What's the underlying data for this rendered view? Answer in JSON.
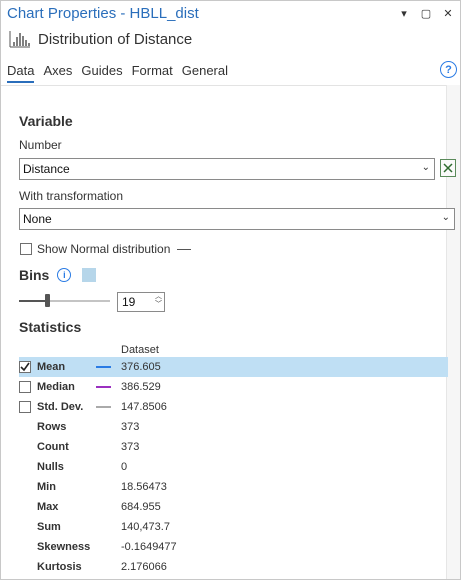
{
  "window": {
    "title": "Chart Properties - HBLL_dist",
    "pin_glyph": "▾",
    "restore_glyph": "▢",
    "close_glyph": "✕"
  },
  "chart": {
    "subtitle": "Distribution of Distance"
  },
  "tabs": [
    {
      "label": "Data",
      "active": true
    },
    {
      "label": "Axes"
    },
    {
      "label": "Guides"
    },
    {
      "label": "Format"
    },
    {
      "label": "General"
    }
  ],
  "help_glyph": "?",
  "variable": {
    "section_title": "Variable",
    "number_label": "Number",
    "number_value": "Distance",
    "transform_label": "With transformation",
    "transform_value": "None",
    "show_normal_label": "Show Normal distribution",
    "show_normal_checked": false
  },
  "bins": {
    "title": "Bins",
    "info_glyph": "i",
    "count": "19",
    "slider_fraction": 0.3,
    "color": "#b6d6ea"
  },
  "statistics": {
    "section_title": "Statistics",
    "column_header": "Dataset",
    "toggles": [
      {
        "name": "Mean",
        "value": "376.605",
        "checked": true,
        "color": "#2a7be4",
        "selected": true
      },
      {
        "name": "Median",
        "value": "386.529",
        "checked": false,
        "color": "#9b30c0"
      },
      {
        "name": "Std. Dev.",
        "value": "147.8506",
        "checked": false,
        "color": "#aaaaaa"
      }
    ],
    "rows": [
      {
        "name": "Rows",
        "value": "373"
      },
      {
        "name": "Count",
        "value": "373"
      },
      {
        "name": "Nulls",
        "value": "0"
      },
      {
        "name": "Min",
        "value": "18.56473"
      },
      {
        "name": "Max",
        "value": "684.955"
      },
      {
        "name": "Sum",
        "value": "140,473.7"
      },
      {
        "name": "Skewness",
        "value": "-0.1649477"
      },
      {
        "name": "Kurtosis",
        "value": "2.176066"
      }
    ]
  },
  "colors": {
    "accent": "#2a6ebb",
    "selection": "#bfdff4"
  }
}
